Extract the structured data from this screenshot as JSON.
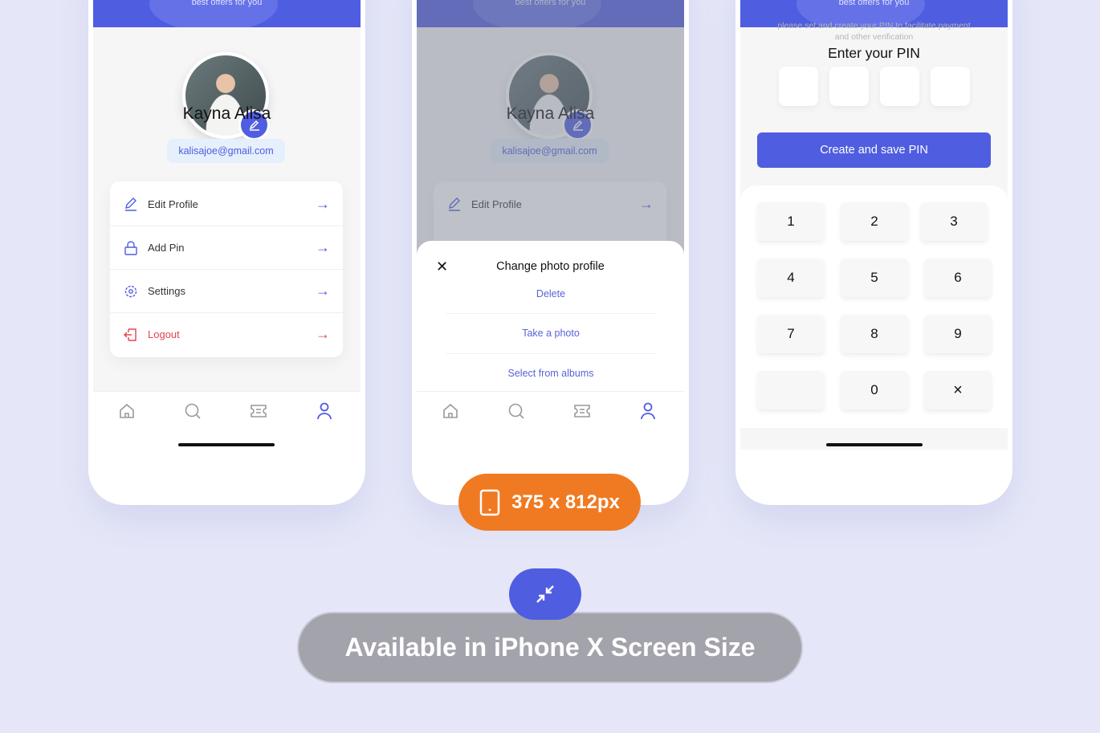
{
  "colors": {
    "primary": "#4f5de0",
    "danger": "#e2464f",
    "badge_orange": "#f07a22",
    "background": "#e5e7f8"
  },
  "banner_text": "best offers for you",
  "profile": {
    "name": "Kayna Alisa",
    "email": "kalisajoe@gmail.com"
  },
  "menu": [
    {
      "label": "Edit Profile",
      "icon": "pencil-icon"
    },
    {
      "label": "Add Pin",
      "icon": "lock-icon"
    },
    {
      "label": "Settings",
      "icon": "gear-icon"
    },
    {
      "label": "Logout",
      "icon": "logout-icon"
    }
  ],
  "nav": [
    "home-icon",
    "search-icon",
    "ticket-icon",
    "user-icon"
  ],
  "sheet": {
    "title": "Change photo profile",
    "options": [
      "Delete",
      "Take a photo",
      "Select from albums"
    ]
  },
  "pin": {
    "title": "Enter your PIN",
    "subtitle_line1": "please set and create your PIN to facilitate payment",
    "subtitle_line2": "and other verification",
    "button": "Create and save PIN",
    "keys": [
      "1",
      "2",
      "3",
      "4",
      "5",
      "6",
      "7",
      "8",
      "9",
      "",
      "0",
      "×"
    ]
  },
  "size_badge": "375 x 812px",
  "footer_label": "Available in iPhone X Screen Size"
}
